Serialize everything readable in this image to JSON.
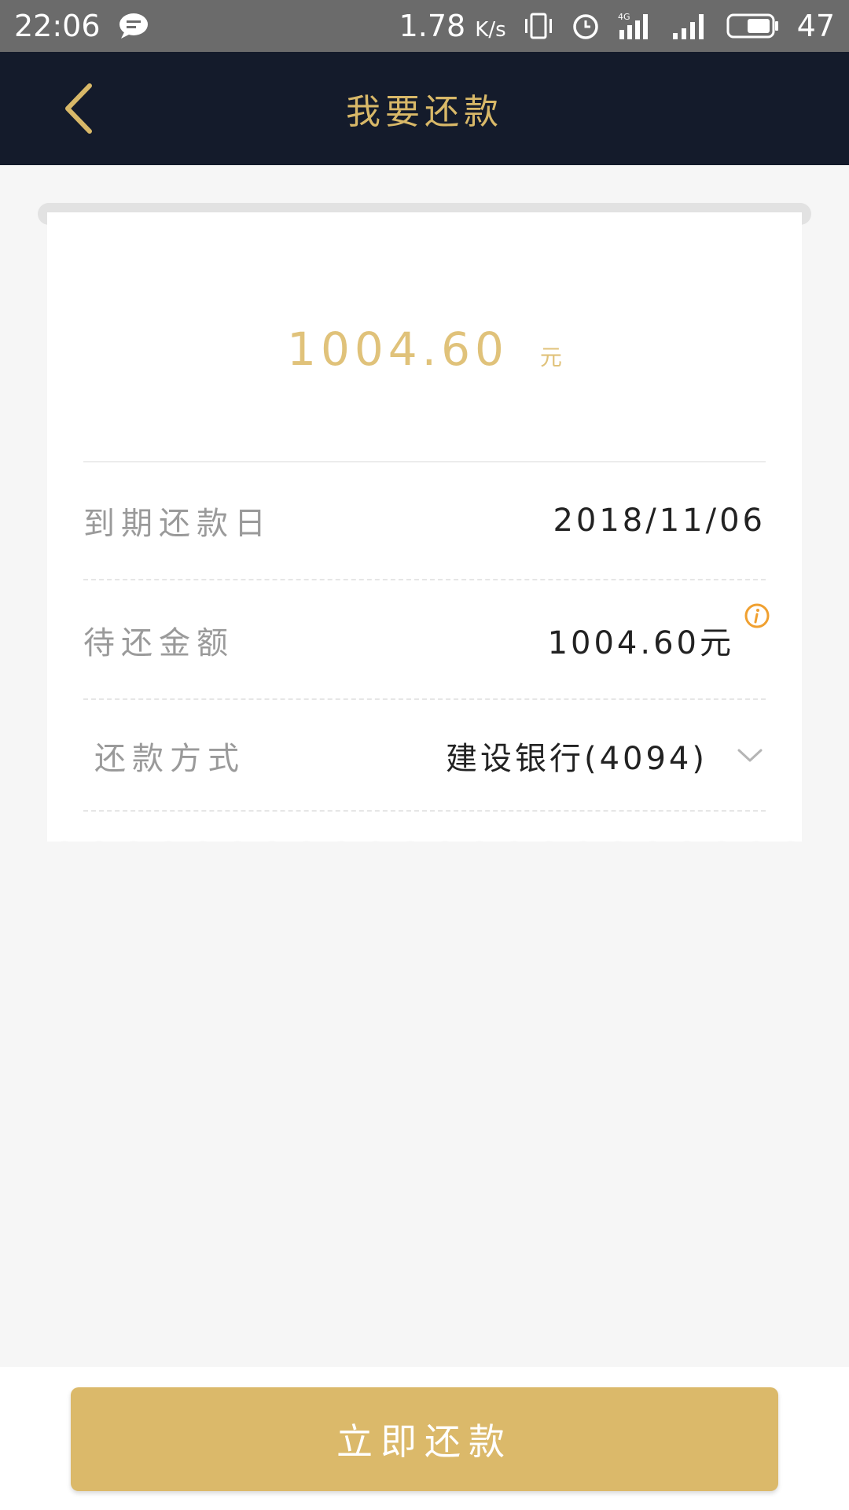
{
  "status_bar": {
    "time": "22:06",
    "net_speed": "1.78",
    "net_speed_unit": "K/s",
    "network": "4G",
    "battery": "47"
  },
  "header": {
    "title": "我要还款",
    "back_icon": "chevron-left-icon"
  },
  "amount": {
    "value": "1004.60",
    "unit": "元"
  },
  "rows": [
    {
      "label": "到期还款日",
      "value": "2018/11/06"
    },
    {
      "label": "待还金额",
      "value": "1004.60元"
    },
    {
      "label": "还款方式",
      "value": "建设银行(4094)"
    }
  ],
  "button": {
    "label": "立即还款"
  },
  "colors": {
    "header_bg": "#141b2b",
    "accent_gold": "#d8b868",
    "button_gold": "#dbb96a",
    "info_orange": "#f0a030"
  }
}
